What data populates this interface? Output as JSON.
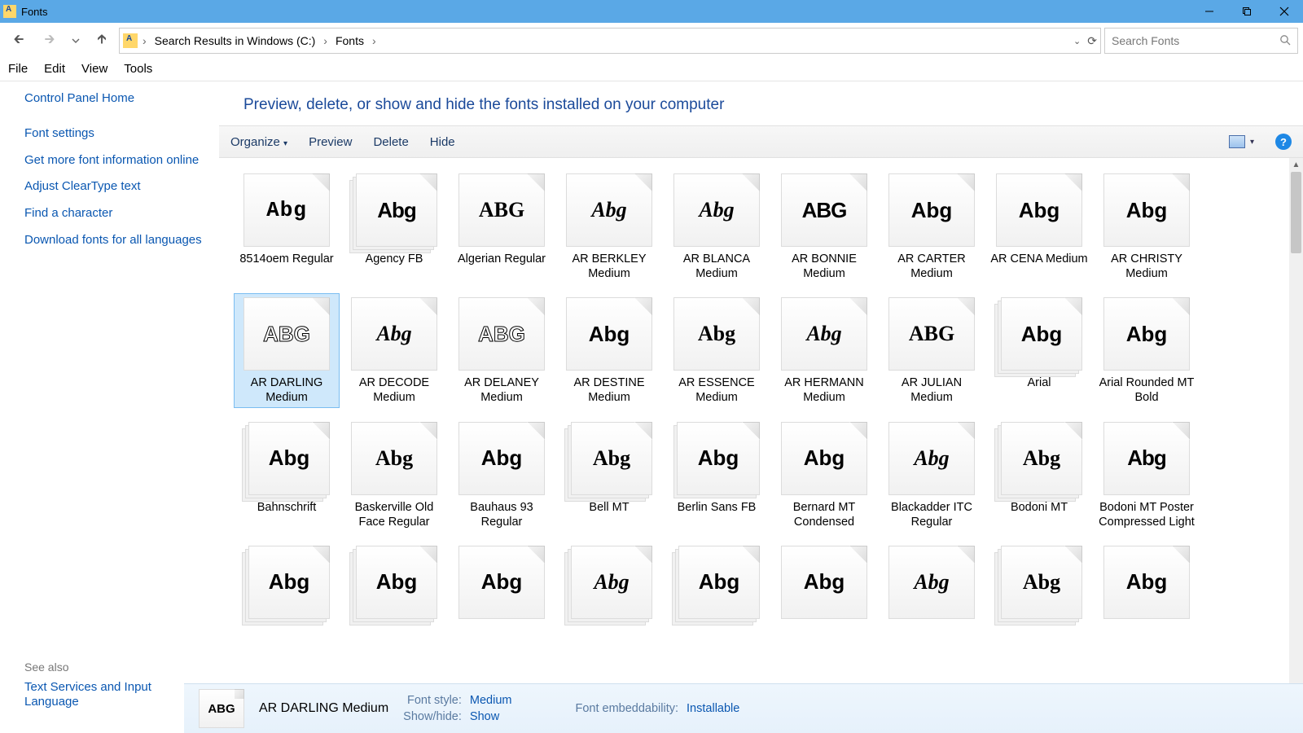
{
  "titlebar": {
    "title": "Fonts"
  },
  "breadcrumb": {
    "seg1": "Search Results in Windows (C:)",
    "seg2": "Fonts"
  },
  "search": {
    "placeholder": "Search Fonts"
  },
  "menu": {
    "file": "File",
    "edit": "Edit",
    "view": "View",
    "tools": "Tools"
  },
  "sidebar": {
    "home": "Control Panel Home",
    "links": [
      "Font settings",
      "Get more font information online",
      "Adjust ClearType text",
      "Find a character",
      "Download fonts for all languages"
    ],
    "seealso_h": "See also",
    "seealso": "Text Services and Input Language"
  },
  "heading": "Preview, delete, or show and hide the fonts installed on your computer",
  "cmdbar": {
    "organize": "Organize",
    "preview": "Preview",
    "delete": "Delete",
    "hide": "Hide"
  },
  "fonts": [
    {
      "name": "8514oem Regular",
      "sample": "Abg",
      "klass": "f-pixel",
      "stack": ""
    },
    {
      "name": "Agency FB",
      "sample": "Abg",
      "klass": "f-narrow",
      "stack": "stack"
    },
    {
      "name": "Algerian Regular",
      "sample": "ABG",
      "klass": "f-serif",
      "stack": ""
    },
    {
      "name": "AR BERKLEY Medium",
      "sample": "Abg",
      "klass": "f-script",
      "stack": ""
    },
    {
      "name": "AR BLANCA Medium",
      "sample": "Abg",
      "klass": "f-script",
      "stack": ""
    },
    {
      "name": "AR BONNIE Medium",
      "sample": "ABG",
      "klass": "f-narrow",
      "stack": ""
    },
    {
      "name": "AR CARTER Medium",
      "sample": "Abg",
      "klass": "",
      "stack": ""
    },
    {
      "name": "AR CENA Medium",
      "sample": "Abg",
      "klass": "f-heavy",
      "stack": ""
    },
    {
      "name": "AR CHRISTY Medium",
      "sample": "Abg",
      "klass": "f-heavy",
      "stack": ""
    },
    {
      "name": "AR DARLING Medium",
      "sample": "ABG",
      "klass": "f-outline",
      "stack": "",
      "selected": true
    },
    {
      "name": "AR DECODE Medium",
      "sample": "Abg",
      "klass": "f-script",
      "stack": ""
    },
    {
      "name": "AR DELANEY Medium",
      "sample": "ABG",
      "klass": "f-outline",
      "stack": ""
    },
    {
      "name": "AR DESTINE Medium",
      "sample": "Abg",
      "klass": "f-heavy",
      "stack": ""
    },
    {
      "name": "AR ESSENCE Medium",
      "sample": "Abg",
      "klass": "f-serif",
      "stack": ""
    },
    {
      "name": "AR HERMANN Medium",
      "sample": "Abg",
      "klass": "f-serif f-italic",
      "stack": ""
    },
    {
      "name": "AR JULIAN Medium",
      "sample": "ABG",
      "klass": "f-serif",
      "stack": ""
    },
    {
      "name": "Arial",
      "sample": "Abg",
      "klass": "",
      "stack": "stack"
    },
    {
      "name": "Arial Rounded MT Bold",
      "sample": "Abg",
      "klass": "f-heavy",
      "stack": ""
    },
    {
      "name": "Bahnschrift",
      "sample": "Abg",
      "klass": "",
      "stack": "stack"
    },
    {
      "name": "Baskerville Old Face Regular",
      "sample": "Abg",
      "klass": "f-serif",
      "stack": ""
    },
    {
      "name": "Bauhaus 93 Regular",
      "sample": "Abg",
      "klass": "f-heavy",
      "stack": ""
    },
    {
      "name": "Bell MT",
      "sample": "Abg",
      "klass": "f-serif",
      "stack": "stack"
    },
    {
      "name": "Berlin Sans FB",
      "sample": "Abg",
      "klass": "f-small",
      "stack": "stack2"
    },
    {
      "name": "Bernard MT Condensed",
      "sample": "Abg",
      "klass": "f-heavy",
      "stack": ""
    },
    {
      "name": "Blackadder ITC Regular",
      "sample": "Abg",
      "klass": "f-script",
      "stack": ""
    },
    {
      "name": "Bodoni MT",
      "sample": "Abg",
      "klass": "f-serif",
      "stack": "stack"
    },
    {
      "name": "Bodoni MT Poster Compressed Light",
      "sample": "Abg",
      "klass": "f-narrow",
      "stack": ""
    },
    {
      "name": "",
      "sample": "Abg",
      "klass": "",
      "stack": "stack"
    },
    {
      "name": "",
      "sample": "Abg",
      "klass": "",
      "stack": "stack"
    },
    {
      "name": "",
      "sample": "Abg",
      "klass": "f-heavy",
      "stack": ""
    },
    {
      "name": "",
      "sample": "Abg",
      "klass": "f-script",
      "stack": "stack"
    },
    {
      "name": "",
      "sample": "Abg",
      "klass": "f-heavy",
      "stack": "stack"
    },
    {
      "name": "",
      "sample": "Abg",
      "klass": "f-heavy",
      "stack": ""
    },
    {
      "name": "",
      "sample": "Abg",
      "klass": "f-script",
      "stack": ""
    },
    {
      "name": "",
      "sample": "Abg",
      "klass": "f-serif",
      "stack": "stack"
    },
    {
      "name": "",
      "sample": "Abg",
      "klass": "",
      "stack": ""
    }
  ],
  "details": {
    "title": "AR DARLING Medium",
    "thumb_sample": "ABG",
    "fontstyle_l": "Font style:",
    "fontstyle_v": "Medium",
    "showhide_l": "Show/hide:",
    "showhide_v": "Show",
    "embed_l": "Font embeddability:",
    "embed_v": "Installable"
  }
}
